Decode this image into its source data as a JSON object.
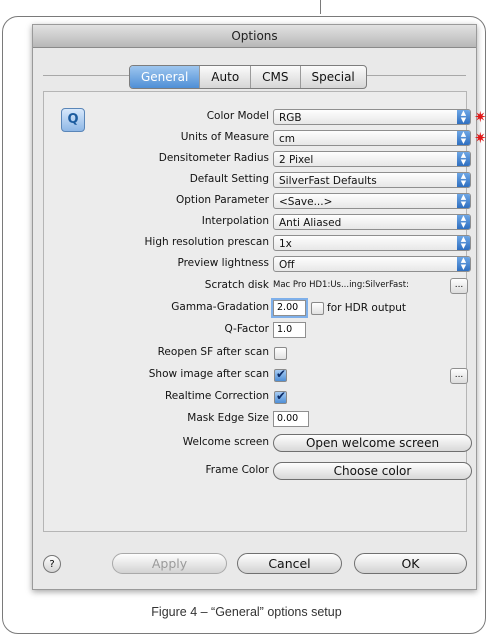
{
  "window": {
    "title": "Options"
  },
  "tabs": [
    {
      "label": "General",
      "active": true
    },
    {
      "label": "Auto",
      "active": false
    },
    {
      "label": "CMS",
      "active": false
    },
    {
      "label": "Special",
      "active": false
    }
  ],
  "settings": {
    "color_model": {
      "label": "Color Model",
      "value": "RGB"
    },
    "units": {
      "label": "Units of Measure",
      "value": "cm"
    },
    "densitometer": {
      "label": "Densitometer Radius",
      "value": "2 Pixel"
    },
    "default_setting": {
      "label": "Default Setting",
      "value": "SilverFast Defaults"
    },
    "option_param": {
      "label": "Option Parameter",
      "value": "<Save...>"
    },
    "interpolation": {
      "label": "Interpolation",
      "value": "Anti Aliased"
    },
    "prescan": {
      "label": "High resolution prescan",
      "value": "1x"
    },
    "preview": {
      "label": "Preview lightness",
      "value": "Off"
    },
    "scratch": {
      "label": "Scratch disk",
      "value": "Mac Pro HD1:Us...ing:SilverFast:",
      "button": "..."
    },
    "gamma": {
      "label": "Gamma-Gradation",
      "value": "2.00",
      "hdr_label": "for HDR output",
      "hdr_checked": false
    },
    "qfactor": {
      "label": "Q-Factor",
      "value": "1.0"
    },
    "reopen": {
      "label": "Reopen SF after scan",
      "checked": false
    },
    "show_image": {
      "label": "Show image after scan",
      "checked": true,
      "button": "..."
    },
    "realtime": {
      "label": "Realtime Correction",
      "checked": true
    },
    "mask_edge": {
      "label": "Mask Edge Size",
      "value": "0.00"
    },
    "welcome": {
      "label": "Welcome screen",
      "button": "Open welcome screen"
    },
    "frame_color": {
      "label": "Frame Color",
      "button": "Choose color"
    }
  },
  "icons": {
    "required_marker": "✷",
    "checkmark": "✔",
    "help": "?",
    "logo": "Q"
  },
  "buttons": {
    "apply": "Apply",
    "cancel": "Cancel",
    "ok": "OK"
  },
  "caption": "Figure 4 – “General” options setup"
}
